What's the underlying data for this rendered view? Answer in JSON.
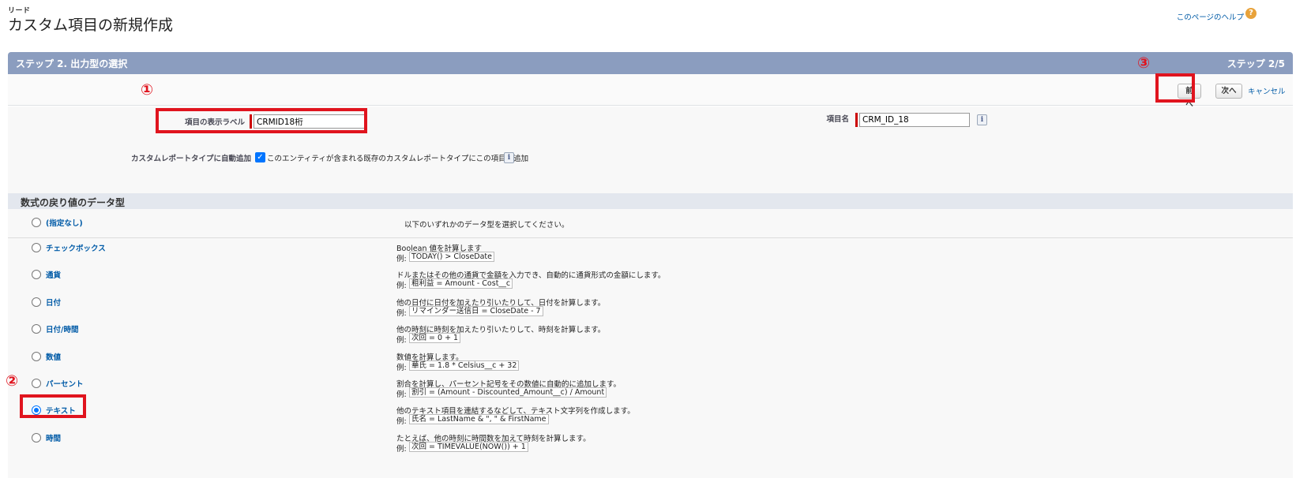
{
  "header": {
    "breadcrumb": "リード",
    "title": "カスタム項目の新規作成",
    "help_link": "このページのヘルプ",
    "help_icon": "question-icon"
  },
  "step": {
    "title": "ステップ 2. 出力型の選択",
    "count": "ステップ 2/5"
  },
  "toolbar": {
    "prev_label": "前へ",
    "next_label": "次へ",
    "cancel_label": "キャンセル"
  },
  "form": {
    "field_label": {
      "label": "項目の表示ラベル",
      "value": "CRMID18桁"
    },
    "field_name": {
      "label": "項目名",
      "value": "CRM_ID_18"
    },
    "auto_add": {
      "label": "カスタムレポートタイプに自動追加",
      "checkbox_text": "このエンティティが含まれる既存のカスタムレポートタイプにこの項目を追加",
      "checked": true
    }
  },
  "types_section": {
    "title": "数式の戻り値のデータ型",
    "none": {
      "label": "(指定なし)",
      "desc": "以下のいずれかのデータ型を選択してください。"
    },
    "example_prefix": "例:",
    "items": [
      {
        "label": "チェックボックス",
        "desc": "Boolean 値を計算します",
        "example": "TODAY() > CloseDate",
        "selected": false
      },
      {
        "label": "通貨",
        "desc": "ドルまたはその他の通貨で金額を入力でき、自動的に通貨形式の金額にします。",
        "example": "粗利益 = Amount - Cost__c",
        "selected": false
      },
      {
        "label": "日付",
        "desc": "他の日付に日付を加えたり引いたりして、日付を計算します。",
        "example": "リマインダー送信日 = CloseDate - 7",
        "selected": false
      },
      {
        "label": "日付/時間",
        "desc": "他の時刻に時刻を加えたり引いたりして、時刻を計算します。",
        "example": "次回 = 0 + 1",
        "selected": false
      },
      {
        "label": "数値",
        "desc": "数値を計算します。",
        "example": "華氏 = 1.8 * Celsius__c + 32",
        "selected": false
      },
      {
        "label": "パーセント",
        "desc": "割合を計算し、パーセント記号をその数値に自動的に追加します。",
        "example": "割引 = (Amount - Discounted_Amount__c) / Amount",
        "selected": false
      },
      {
        "label": "テキスト",
        "desc": "他のテキスト項目を連結するなどして、テキスト文字列を作成します。",
        "example": "氏名 = LastName & \", \" & FirstName",
        "selected": true
      },
      {
        "label": "時間",
        "desc": "たとえば、他の時刻に時間数を加えて時刻を計算します。",
        "example": "次回 = TIMEVALUE(NOW()) + 1",
        "selected": false
      }
    ]
  },
  "annotations": {
    "marker_1": "①",
    "marker_2": "②",
    "marker_3": "③",
    "highlight_color": "#e0141e"
  },
  "colors": {
    "step_header": "#8b9dbf",
    "link": "#015ba7",
    "required": "#cc0000",
    "radio_selected": "#0075ff"
  }
}
